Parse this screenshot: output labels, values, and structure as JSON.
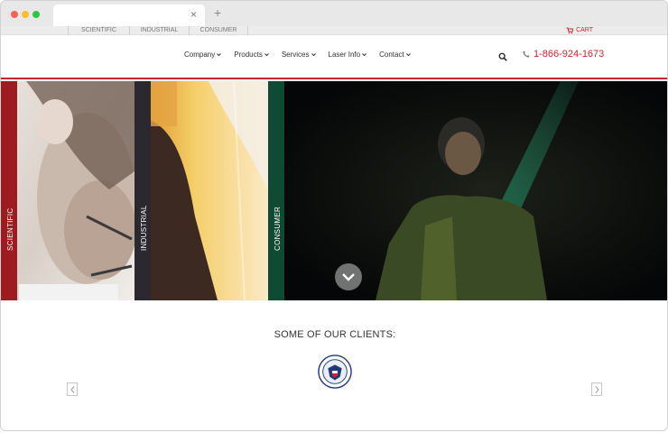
{
  "browser": {
    "tab_close_glyph": "×",
    "new_tab_glyph": "+"
  },
  "topbar": {
    "categories": [
      "SCIENTIFIC",
      "INDUSTRIAL",
      "CONSUMER"
    ],
    "cart_label": "CART",
    "cart_icon": "cart-icon"
  },
  "nav": {
    "items": [
      "Company",
      "Products",
      "Services",
      "Laser Info",
      "Contact"
    ],
    "search_icon": "search-icon",
    "phone_icon": "phone-icon",
    "phone": "1-866-924-1673"
  },
  "hero": {
    "panels": [
      {
        "label": "SCIENTIFIC",
        "color": "#9c1c22"
      },
      {
        "label": "INDUSTRIAL",
        "color": "#2c2830"
      },
      {
        "label": "CONSUMER",
        "color": "#0f4a35"
      }
    ],
    "scroll_icon": "chevron-down-icon"
  },
  "clients": {
    "title": "SOME OF OUR CLIENTS:",
    "logo": "seal-logo"
  },
  "colors": {
    "brand_red": "#c8262d",
    "laser_green": "#2fd39a"
  }
}
